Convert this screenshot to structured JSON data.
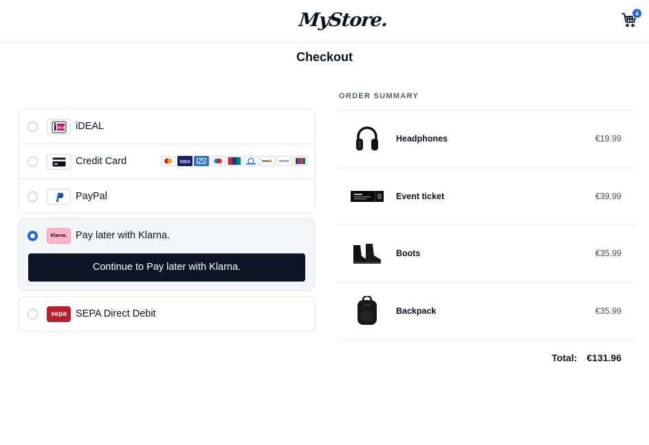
{
  "header": {
    "logo_text": "MyStore.",
    "cart_count": "4"
  },
  "page": {
    "title": "Checkout"
  },
  "payment_methods": [
    {
      "label": "iDEAL",
      "icon": "ideal-logo",
      "selected": false
    },
    {
      "label": "Credit Card",
      "icon": "credit-card-icon",
      "selected": false,
      "card_brands": [
        "mastercard",
        "visa",
        "amex",
        "maestro",
        "unionpay",
        "diners",
        "discover",
        "elo",
        "jcb"
      ]
    },
    {
      "label": "PayPal",
      "icon": "paypal-logo",
      "selected": false
    },
    {
      "label": "Pay later with Klarna.",
      "icon": "klarna-logo",
      "icon_text": "Klarna.",
      "selected": true,
      "button_label": "Continue to Pay later with Klarna."
    },
    {
      "label": "SEPA Direct Debit",
      "icon": "sepa-logo",
      "icon_text": "sepa",
      "selected": false
    }
  ],
  "order_summary": {
    "title": "ORDER SUMMARY",
    "items": [
      {
        "name": "Headphones",
        "price": "€19.99",
        "image": "headphones-image"
      },
      {
        "name": "Event ticket",
        "price": "€39.99",
        "image": "ticket-image"
      },
      {
        "name": "Boots",
        "price": "€35.99",
        "image": "boots-image"
      },
      {
        "name": "Backpack",
        "price": "€35.99",
        "image": "backpack-image"
      }
    ],
    "total_label": "Total:",
    "total_value": "€131.96"
  },
  "colors": {
    "accent": "#1a64e6",
    "button_bg": "#0b1526",
    "klarna_pink": "#ffb3c7",
    "sepa_red": "#b8202f",
    "selected_bg": "#f3f5f8"
  }
}
